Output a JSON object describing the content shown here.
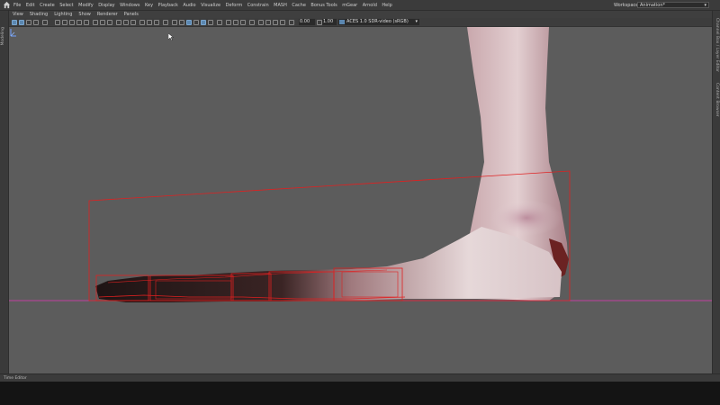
{
  "menu": [
    "File",
    "Edit",
    "Create",
    "Select",
    "Modify",
    "Display",
    "Windows",
    "Key",
    "Playback",
    "Audio",
    "Visualize",
    "Deform",
    "Constrain",
    "MASH",
    "Cache",
    "Bonus Tools",
    "mGear",
    "Arnold",
    "Help"
  ],
  "workspace": {
    "label": "Workspace:",
    "value": "Animation*"
  },
  "panel_menu": [
    "View",
    "Shading",
    "Lighting",
    "Show",
    "Renderer",
    "Panels"
  ],
  "toolbar": {
    "field_1": "0.00",
    "field_2": "1.00",
    "color_space": "ACES 1.0 SDR-video (sRGB)"
  },
  "left_strip_label": "Modeling",
  "right_strip_labels": [
    "Channel Box / Layer Editor",
    "Content Browser"
  ],
  "time_editor_label": "Time Editor",
  "icons": {
    "home": "home-icon",
    "dropdown": "chevron-down-icon",
    "axis": "axis-gizmo-icon",
    "cursor": "mouse-cursor-icon"
  },
  "colors": {
    "viewport_bg": "#5c5c5c",
    "grid_line": "#c040a0",
    "selection_box": "#e02020",
    "accent": "#5b87b0"
  }
}
